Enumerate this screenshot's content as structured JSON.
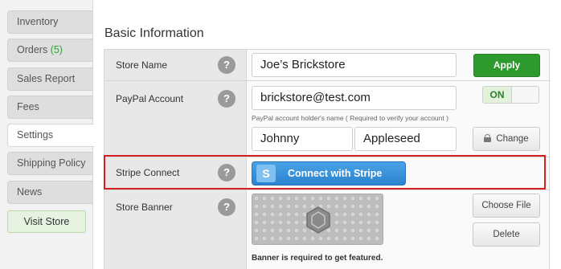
{
  "sidebar": {
    "items": [
      {
        "label": "Inventory"
      },
      {
        "label": "Orders",
        "count": "(5)"
      },
      {
        "label": "Sales Report"
      },
      {
        "label": "Fees"
      },
      {
        "label": "Settings"
      },
      {
        "label": "Shipping Policy"
      },
      {
        "label": "News"
      }
    ],
    "visit_store": "Visit Store"
  },
  "main": {
    "section_title": "Basic Information",
    "help_symbol": "?",
    "store_name": {
      "label": "Store Name",
      "value": "Joe’s Brickstore",
      "apply_label": "Apply"
    },
    "paypal": {
      "label": "PayPal Account",
      "email": "brickstore@test.com",
      "toggle": "ON",
      "hint": "PayPal account holder's name ( Required to verify your account )",
      "first_name": "Johnny",
      "last_name": "Appleseed",
      "change_label": "Change"
    },
    "stripe": {
      "label": "Stripe Connect",
      "button_icon": "S",
      "button_label": "Connect with Stripe"
    },
    "banner": {
      "label": "Store Banner",
      "choose_file": "Choose File",
      "delete": "Delete",
      "note": "Banner is required to get featured."
    }
  },
  "colors": {
    "apply_green": "#2e9a2e",
    "stripe_blue": "#2b82cf",
    "highlight_red": "#d21f1f"
  }
}
